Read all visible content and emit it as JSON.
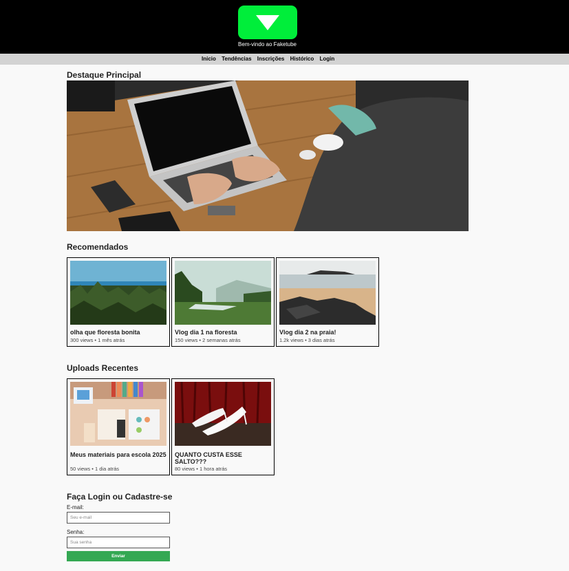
{
  "header": {
    "welcome": "Bem-vindo ao Faketube",
    "logo_color": "#00ee3a"
  },
  "nav": {
    "items": [
      "Inicio",
      "Tendências",
      "Inscrições",
      "Histórico",
      "Login"
    ]
  },
  "featured": {
    "heading": "Destaque Principal"
  },
  "recommended": {
    "heading": "Recomendados",
    "videos": [
      {
        "title": "olha que floresta bonita",
        "meta": "300 views • 1 mês atrás"
      },
      {
        "title": "Vlog dia 1 na floresta",
        "meta": "150 views • 2 semanas atrás"
      },
      {
        "title": "Vlog dia 2 na praia!",
        "meta": "1.2k views • 3 dias atrás"
      }
    ]
  },
  "recent": {
    "heading": "Uploads Recentes",
    "videos": [
      {
        "title": "Meus materiais para escola 2025",
        "meta": "50 views • 1 dia atrás"
      },
      {
        "title": "QUANTO CUSTA ESSE SALTO???",
        "meta": "80 views • 1 hora atrás"
      }
    ]
  },
  "login": {
    "heading": "Faça Login ou Cadastre-se",
    "email_label": "E-mail:",
    "email_placeholder": "Seu e-mail",
    "password_label": "Senha:",
    "password_placeholder": "Sua senha",
    "submit_label": "Enviar",
    "submit_color": "#34a853"
  }
}
